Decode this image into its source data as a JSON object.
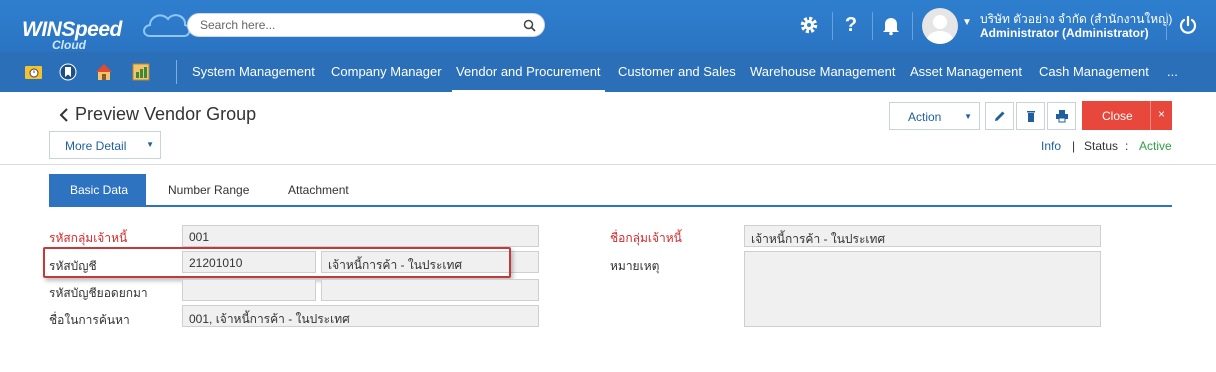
{
  "header": {
    "brand": "WINSpeed",
    "brand_sub": "Cloud",
    "search_placeholder": "Search here...",
    "company": "บริษัท ตัวอย่าง จำกัด (สำนักงานใหญ่)",
    "user": "Administrator (Administrator)",
    "icons": [
      "gear-icon",
      "help-icon",
      "bell-icon",
      "power-icon"
    ]
  },
  "nav": {
    "quick_icons": [
      "folder-clock-icon",
      "bookmark-icon",
      "home-icon",
      "report-icon"
    ],
    "items": [
      {
        "label": "System Management"
      },
      {
        "label": "Company Manager"
      },
      {
        "label": "Vendor and Procurement"
      },
      {
        "label": "Customer and Sales"
      },
      {
        "label": "Warehouse Management"
      },
      {
        "label": "Asset Management"
      },
      {
        "label": "Cash Management"
      },
      {
        "label": "..."
      }
    ],
    "active_index": 2
  },
  "page": {
    "title": "Preview Vendor Group",
    "more_detail": "More Detail",
    "action": "Action",
    "close": "Close",
    "close_x": "×",
    "info": "Info",
    "info_sep": "|",
    "status_label": "Status",
    "status_colon": ":",
    "status_value": "Active"
  },
  "tabs": [
    {
      "label": "Basic Data"
    },
    {
      "label": "Number Range"
    },
    {
      "label": "Attachment"
    }
  ],
  "form": {
    "group_code_label": "รหัสกลุ่มเจ้าหนี้",
    "group_code": "001",
    "account_code_label": "รหัสบัญชี",
    "account_code": "21201010",
    "account_name": "เจ้าหนี้การค้า - ในประเทศ",
    "carried_account_label": "รหัสบัญชียอดยกมา",
    "carried_account_code": "",
    "carried_account_name": "",
    "search_name_label": "ชื่อในการค้นหา",
    "search_name": "001, เจ้าหนี้การค้า - ในประเทศ",
    "group_name_label": "ชื่อกลุ่มเจ้าหนี้",
    "group_name": "เจ้าหนี้การค้า - ในประเทศ",
    "remark_label": "หมายเหตุ",
    "remark": ""
  },
  "colors": {
    "header": "#2f7fcf",
    "nav": "#2a6fb8",
    "accent": "#2e73bf",
    "close": "#e8473c",
    "required": "#d32a2a",
    "active_status": "#2ea043"
  }
}
